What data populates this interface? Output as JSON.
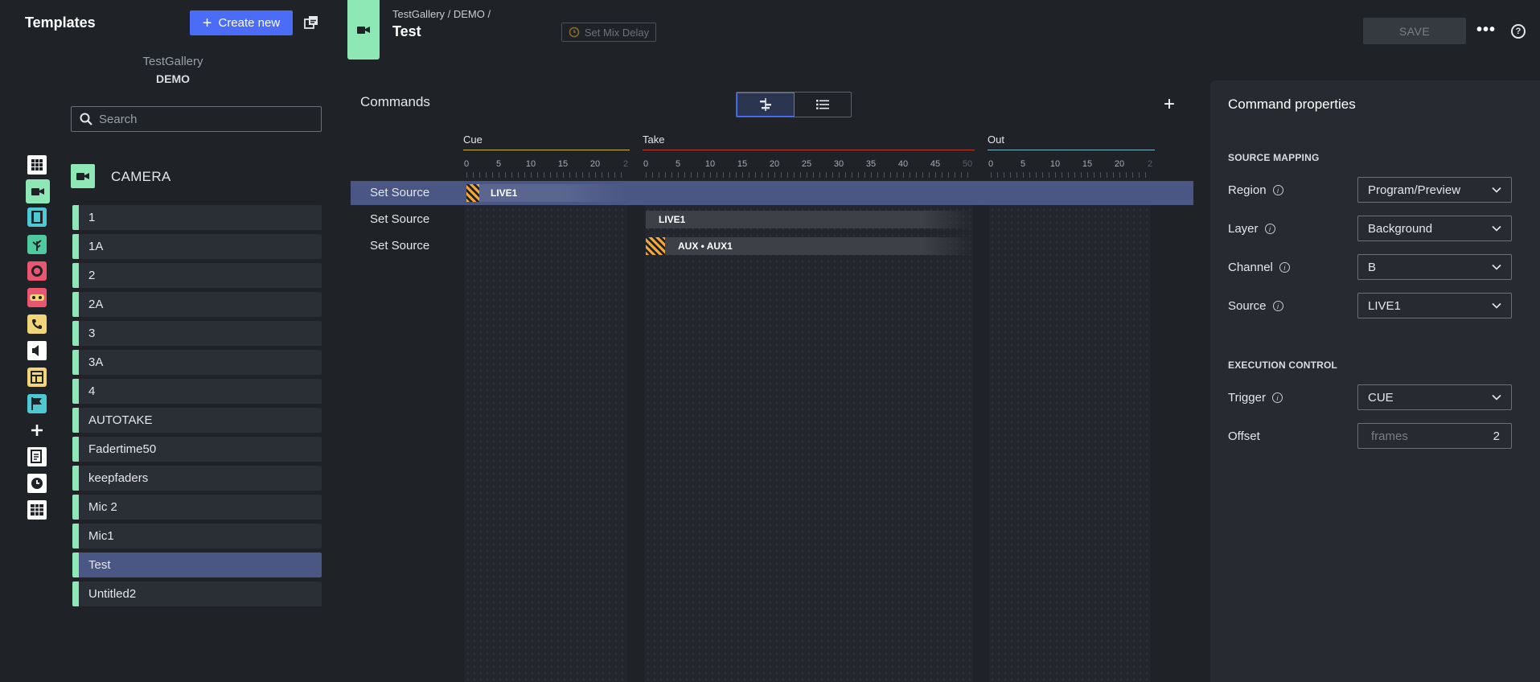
{
  "sidebar": {
    "title": "Templates",
    "create_label": "Create new",
    "gallery_name": "TestGallery",
    "gallery_show": "DEMO",
    "search_placeholder": "Search",
    "category": "CAMERA",
    "category_icons": [
      {
        "name": "grid-icon",
        "color": "#ffffff"
      },
      {
        "name": "camera-icon",
        "color": "#8ee8b6"
      },
      {
        "name": "film-icon",
        "color": "#4ec9d4"
      },
      {
        "name": "plant-icon",
        "color": "#4ec9a0"
      },
      {
        "name": "record-icon",
        "color": "#e8566f"
      },
      {
        "name": "gamepad-icon",
        "color": "#e8566f"
      },
      {
        "name": "phone-icon",
        "color": "#f2d479"
      },
      {
        "name": "speaker-icon",
        "color": "#ffffff"
      },
      {
        "name": "layout-icon",
        "color": "#f2d479"
      },
      {
        "name": "flag-icon",
        "color": "#4ec9d4"
      },
      {
        "name": "plus-icon",
        "color": "#ffffff"
      },
      {
        "name": "script-icon",
        "color": "#ffffff"
      },
      {
        "name": "clock-icon",
        "color": "#ffffff"
      },
      {
        "name": "table-icon",
        "color": "#ffffff"
      }
    ],
    "templates": [
      "1",
      "1A",
      "2",
      "2A",
      "3",
      "3A",
      "4",
      "AUTOTAKE",
      "Fadertime50",
      "keepfaders",
      "Mic 2",
      "Mic1",
      "Test",
      "Untitled2"
    ],
    "selected_template": "Test"
  },
  "header": {
    "breadcrumb": "TestGallery / DEMO /",
    "title": "Test",
    "mix_delay_label": "Set Mix Delay",
    "save_label": "SAVE",
    "more_label": "•••",
    "help_label": "?"
  },
  "commands": {
    "title": "Commands",
    "add_label": "+",
    "phases": [
      {
        "name": "Cue",
        "color": "#c9b53a",
        "ticks": [
          "0",
          "5",
          "10",
          "15",
          "20",
          "2"
        ]
      },
      {
        "name": "Take",
        "color": "#c0392b",
        "ticks": [
          "0",
          "5",
          "10",
          "15",
          "20",
          "25",
          "30",
          "35",
          "40",
          "45",
          "50"
        ]
      },
      {
        "name": "Out",
        "color": "#7fb8c9",
        "ticks": [
          "0",
          "5",
          "10",
          "15",
          "20",
          "2"
        ]
      }
    ],
    "rows": [
      {
        "label": "Set Source",
        "bar": "LIVE1",
        "phase": "Cue",
        "selected": true
      },
      {
        "label": "Set Source",
        "bar": "LIVE1",
        "phase": "Take",
        "selected": false
      },
      {
        "label": "Set Source",
        "bar": "AUX • AUX1",
        "phase": "Take",
        "selected": false
      }
    ]
  },
  "properties": {
    "title": "Command properties",
    "source_mapping": "SOURCE MAPPING",
    "execution_control": "EXECUTION CONTROL",
    "region_label": "Region",
    "region_value": "Program/Preview",
    "layer_label": "Layer",
    "layer_value": "Background",
    "channel_label": "Channel",
    "channel_value": "B",
    "source_label": "Source",
    "source_value": "LIVE1",
    "trigger_label": "Trigger",
    "trigger_value": "CUE",
    "offset_label": "Offset",
    "offset_placeholder": "frames",
    "offset_value": "2"
  }
}
